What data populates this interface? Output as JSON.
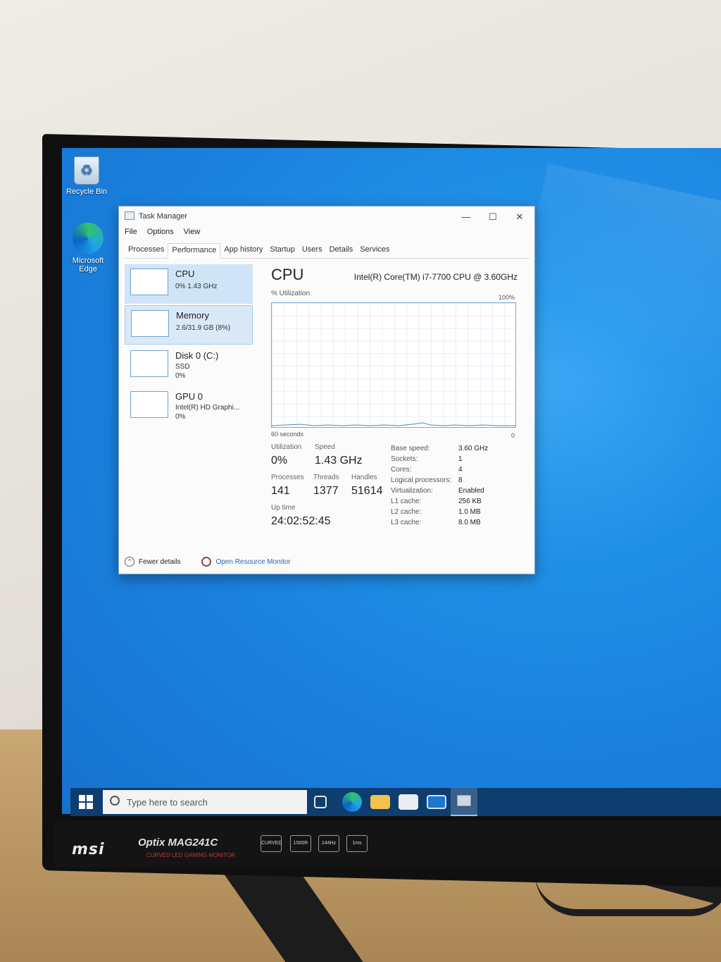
{
  "desktop": {
    "icons": [
      {
        "label": "Recycle Bin",
        "icon": "recycle-bin-icon"
      },
      {
        "label": "Microsoft Edge",
        "icon": "edge-icon"
      }
    ]
  },
  "task_manager": {
    "title": "Task Manager",
    "menu": [
      "File",
      "Options",
      "View"
    ],
    "tabs": [
      "Processes",
      "Performance",
      "App history",
      "Startup",
      "Users",
      "Details",
      "Services"
    ],
    "active_tab": "Performance",
    "sidebar": [
      {
        "name": "CPU",
        "sub1": "0% 1.43 GHz",
        "sub2": ""
      },
      {
        "name": "Memory",
        "sub1": "2.6/31.9 GB (8%)",
        "sub2": ""
      },
      {
        "name": "Disk 0 (C:)",
        "sub1": "SSD",
        "sub2": "0%"
      },
      {
        "name": "GPU 0",
        "sub1": "Intel(R) HD Graphi...",
        "sub2": "0%"
      }
    ],
    "main": {
      "title": "CPU",
      "model": "Intel(R) Core(TM) i7-7700 CPU @ 3.60GHz",
      "util_label": "% Utilization",
      "max_label": "100%",
      "time_label": "60 seconds",
      "min_label": "0",
      "stats": {
        "utilization_label": "Utilization",
        "utilization": "0%",
        "speed_label": "Speed",
        "speed": "1.43 GHz",
        "processes_label": "Processes",
        "processes": "141",
        "threads_label": "Threads",
        "threads": "1377",
        "handles_label": "Handles",
        "handles": "51614",
        "uptime_label": "Up time",
        "uptime": "24:02:52:45"
      },
      "specs": [
        {
          "label": "Base speed:",
          "value": "3.60 GHz"
        },
        {
          "label": "Sockets:",
          "value": "1"
        },
        {
          "label": "Cores:",
          "value": "4"
        },
        {
          "label": "Logical processors:",
          "value": "8"
        },
        {
          "label": "Virtualization:",
          "value": "Enabled"
        },
        {
          "label": "L1 cache:",
          "value": "256 KB"
        },
        {
          "label": "L2 cache:",
          "value": "1.0 MB"
        },
        {
          "label": "L3 cache:",
          "value": "8.0 MB"
        }
      ]
    },
    "footer": {
      "fewer_details": "Fewer details",
      "open_resource_monitor": "Open Resource Monitor"
    }
  },
  "taskbar": {
    "search_placeholder": "Type here to search",
    "pinned": [
      "task-view-icon",
      "edge-icon",
      "file-explorer-icon",
      "store-icon",
      "mail-icon",
      "task-manager-icon"
    ]
  },
  "monitor": {
    "brand": "msi",
    "model": "Optix MAG241C",
    "tagline": "CURVED LED GAMING MONITOR",
    "badges": [
      "CURVED",
      "1500R",
      "144Hz",
      "1ms"
    ]
  },
  "colors": {
    "desktop": "#1a7fdc",
    "taskbar": "#0e3d6f",
    "link": "#2a63b8",
    "selection": "#cfe4f6"
  }
}
